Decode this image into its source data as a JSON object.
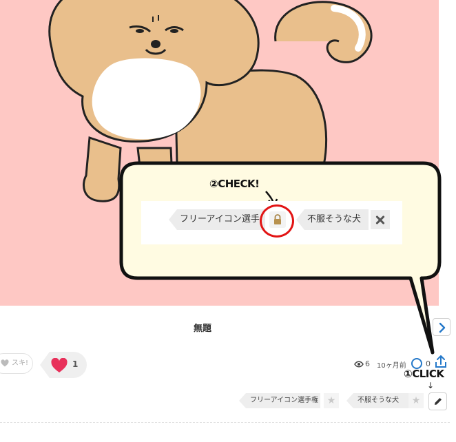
{
  "callout": {
    "check_label": "②CHECK!",
    "tag1_label": "フリーアイコン選手権",
    "tag2_label": "不服そうな犬"
  },
  "post": {
    "title": "無題",
    "suki_label": "スキ!",
    "like_count": "1",
    "views": "6",
    "time_ago": "10ヶ月前",
    "comments": "0"
  },
  "annotation": {
    "click_label": "①CLICK",
    "click_arrow": "↓"
  },
  "tags": [
    {
      "label": "フリーアイコン選手権"
    },
    {
      "label": "不服そうな犬"
    }
  ],
  "icons": {
    "next": "chevron-right-icon",
    "lock": "lock-icon",
    "remove": "close-icon",
    "heart": "heart-icon",
    "eye": "eye-icon",
    "comment": "comment-icon",
    "share": "share-icon",
    "star": "star-icon",
    "edit": "pencil-icon"
  },
  "colors": {
    "art_background": "#fec8c4",
    "callout_fill": "#fffbe2",
    "highlight_ring": "#e21414",
    "heart": "#e8305a",
    "accent_blue": "#2478c9"
  }
}
